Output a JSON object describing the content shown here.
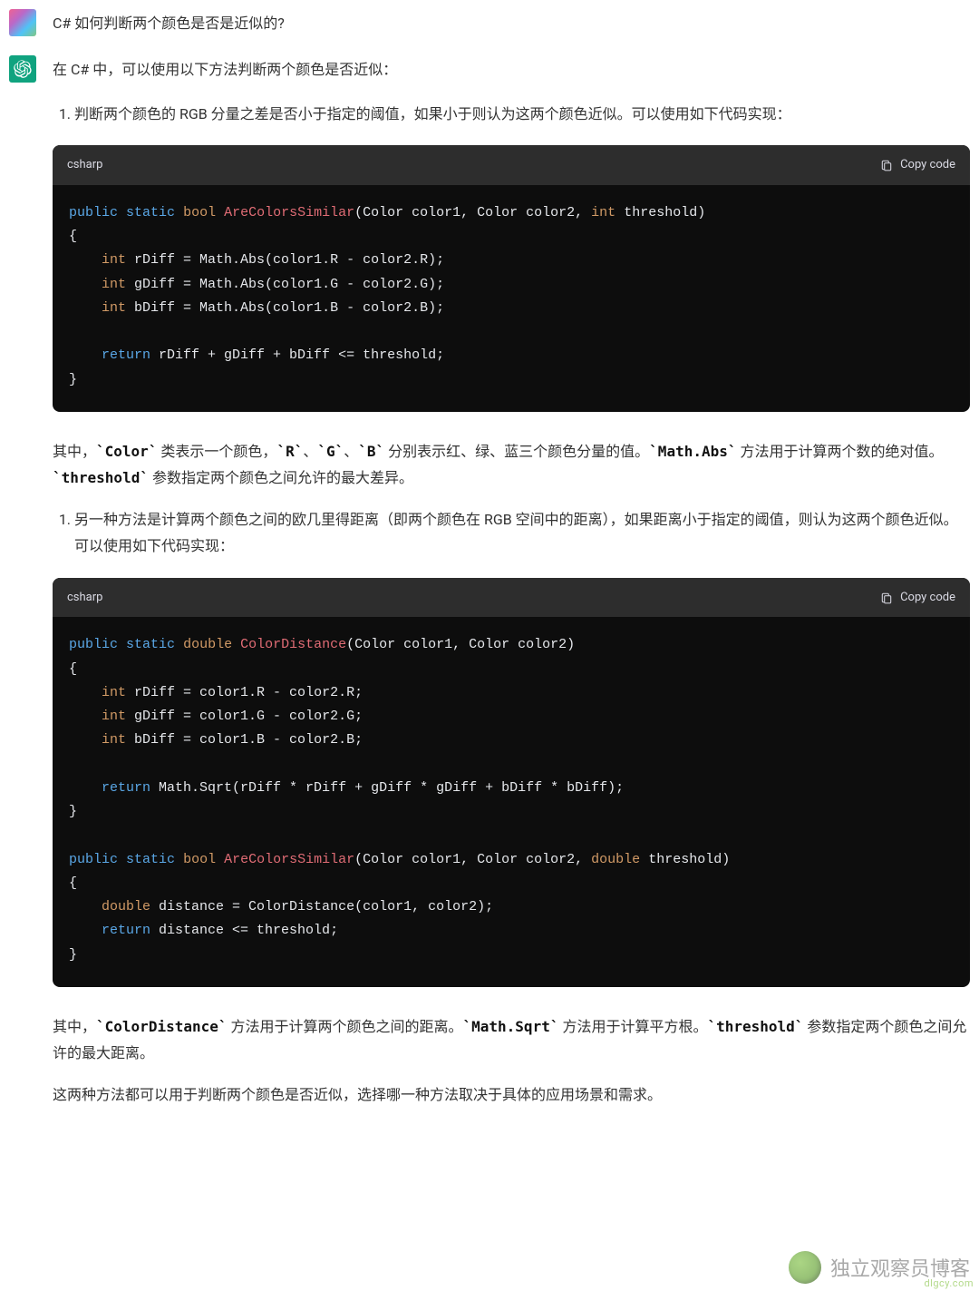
{
  "user": {
    "question": "C# 如何判断两个颜色是否是近似的?"
  },
  "assistant": {
    "intro": "在 C# 中，可以使用以下方法判断两个颜色是否近似：",
    "method1_text": "判断两个颜色的 RGB 分量之差是否小于指定的阈值，如果小于则认为这两个颜色近似。可以使用如下代码实现：",
    "code1": {
      "lang": "csharp",
      "copy": "Copy code",
      "kw_public": "public",
      "kw_static": "static",
      "kw_bool": "bool",
      "kw_int": "int",
      "kw_return": "return",
      "fn": "AreColorsSimilar",
      "sig_tail": "(Color color1, Color color2, ",
      "sig_threshold": " threshold)",
      "l_open": "{",
      "l_r": " rDiff = Math.Abs(color1.R - color2.R);",
      "l_g": " gDiff = Math.Abs(color1.G - color2.G);",
      "l_b": " bDiff = Math.Abs(color1.B - color2.B);",
      "l_ret": " rDiff + gDiff + bDiff <= threshold;",
      "l_close": "}"
    },
    "explanation1_pre": "其中，",
    "explanation1_color": "`Color`",
    "explanation1_mid1": " 类表示一个颜色，",
    "explanation1_r": "`R`",
    "explanation1_sep1": "、",
    "explanation1_g": "`G`",
    "explanation1_sep2": "、",
    "explanation1_b": "`B`",
    "explanation1_mid2": " 分别表示红、绿、蓝三个颜色分量的值。",
    "explanation1_abs": "`Math.Abs`",
    "explanation1_mid3": " 方法用于计算两个数的绝对值。",
    "explanation1_threshold": "`threshold`",
    "explanation1_mid4": " 参数指定两个颜色之间允许的最大差异。",
    "method2_text": "另一种方法是计算两个颜色之间的欧几里得距离（即两个颜色在 RGB 空间中的距离），如果距离小于指定的阈值，则认为这两个颜色近似。可以使用如下代码实现：",
    "code2": {
      "lang": "csharp",
      "copy": "Copy code",
      "kw_public": "public",
      "kw_static": "static",
      "kw_double": "double",
      "kw_bool": "bool",
      "kw_int": "int",
      "kw_return": "return",
      "fn1": "ColorDistance",
      "sig1_tail": "(Color color1, Color color2)",
      "l_open": "{",
      "l_r": " rDiff = color1.R - color2.R;",
      "l_g": " gDiff = color1.G - color2.G;",
      "l_b": " bDiff = color1.B - color2.B;",
      "l_ret1": " Math.Sqrt(rDiff * rDiff + gDiff * gDiff + bDiff * bDiff);",
      "l_close": "}",
      "fn2": "AreColorsSimilar",
      "sig2_tail1": "(Color color1, Color color2, ",
      "sig2_threshold": " threshold)",
      "l_dist": " distance = ColorDistance(color1, color2);",
      "l_ret2": " distance <= threshold;"
    },
    "explanation2_pre": "其中，",
    "explanation2_cd": "`ColorDistance`",
    "explanation2_mid1": " 方法用于计算两个颜色之间的距离。",
    "explanation2_sqrt": "`Math.Sqrt`",
    "explanation2_mid2": " 方法用于计算平方根。",
    "explanation2_threshold": "`threshold`",
    "explanation2_mid3": " 参数指定两个颜色之间允许的最大距离。",
    "conclusion": "这两种方法都可以用于判断两个颜色是否近似，选择哪一种方法取决于具体的应用场景和需求。"
  },
  "watermark": {
    "text": "独立观察员博客",
    "sub": "dlgcy.com"
  }
}
